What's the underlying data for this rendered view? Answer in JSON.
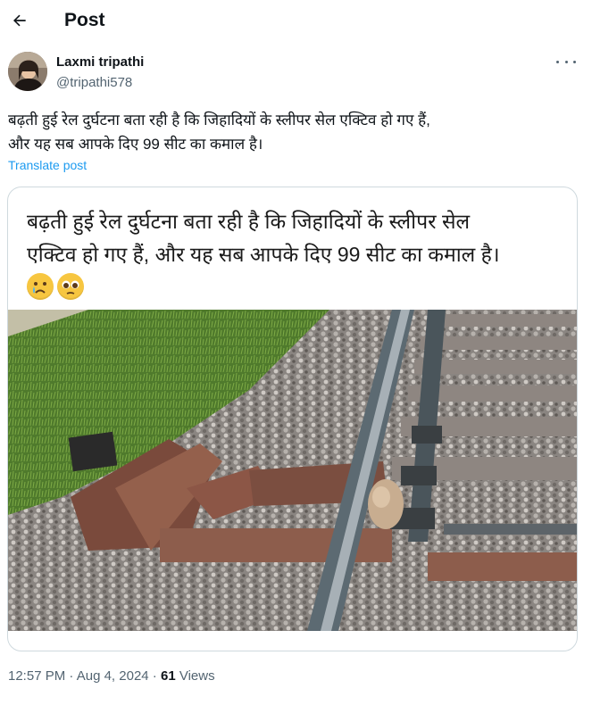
{
  "header": {
    "title": "Post"
  },
  "author": {
    "name": "Laxmi tripathi",
    "handle": "@tripathi578"
  },
  "post": {
    "text": "बढ़ती हुई रेल दुर्घटना बता रही है कि जिहादियों के स्लीपर सेल एक्टिव हो गए हैं,\nऔर यह सब आपके दिए 99 सीट का कमाल है।",
    "translate_label": "Translate post"
  },
  "media": {
    "caption": "बढ़ती हुई रेल दुर्घटना बता रही है कि जिहादियों के स्लीपर सेल\nएक्टिव हो गए हैं, और यह सब आपके दिए 99 सीट का कमाल है।",
    "emojis": [
      "crying-face",
      "pleading-face"
    ]
  },
  "meta": {
    "time": "12:57 PM",
    "separator": " · ",
    "date": "Aug 4, 2024",
    "views_count": "61",
    "views_label": "Views"
  },
  "colors": {
    "accent": "#1d9bf0",
    "secondary_text": "#536471",
    "border": "#cfd9de"
  }
}
